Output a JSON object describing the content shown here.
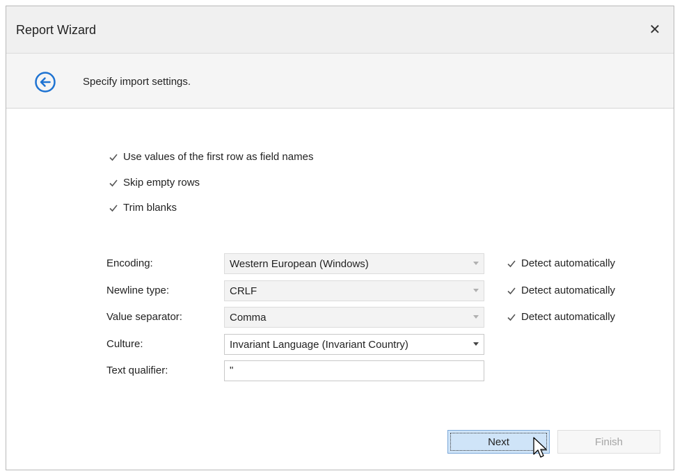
{
  "window": {
    "title": "Report Wizard"
  },
  "header": {
    "text": "Specify import settings."
  },
  "options": [
    {
      "label": "Use values of the first row as field names",
      "checked": true
    },
    {
      "label": "Skip empty rows",
      "checked": true
    },
    {
      "label": "Trim blanks",
      "checked": true
    }
  ],
  "fields": {
    "encoding": {
      "label": "Encoding:",
      "value": "Western European (Windows)",
      "detect_label": "Detect automatically",
      "detect_checked": true
    },
    "newline": {
      "label": "Newline type:",
      "value": "CRLF",
      "detect_label": "Detect automatically",
      "detect_checked": true
    },
    "separator": {
      "label": "Value separator:",
      "value": "Comma",
      "detect_label": "Detect automatically",
      "detect_checked": true
    },
    "culture": {
      "label": "Culture:",
      "value": "Invariant Language (Invariant Country)"
    },
    "qualifier": {
      "label": "Text qualifier:",
      "value": "\""
    }
  },
  "buttons": {
    "next": "Next",
    "finish": "Finish"
  },
  "colors": {
    "accent": "#1e73d2",
    "check": "#555555"
  },
  "icons": {
    "back": "back-arrow-circle-icon",
    "close": "close-icon",
    "check": "checkmark-icon",
    "cursor": "mouse-pointer-icon"
  }
}
